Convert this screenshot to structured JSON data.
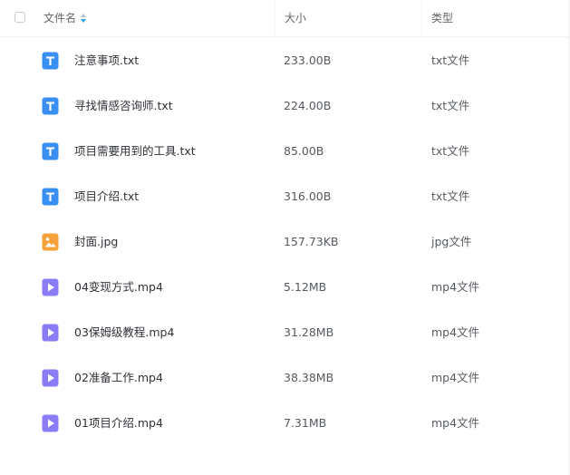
{
  "header": {
    "name_label": "文件名",
    "size_label": "大小",
    "type_label": "类型"
  },
  "colors": {
    "txt_icon": "#3a8ff5",
    "jpg_icon": "#f6a23b",
    "mp4_icon": "#8a7cf7"
  },
  "files": [
    {
      "name": "注意事项.txt",
      "size": "233.00B",
      "type": "txt文件",
      "icon": "text-file-icon",
      "kind": "txt"
    },
    {
      "name": "寻找情感咨询师.txt",
      "size": "224.00B",
      "type": "txt文件",
      "icon": "text-file-icon",
      "kind": "txt"
    },
    {
      "name": "项目需要用到的工具.txt",
      "size": "85.00B",
      "type": "txt文件",
      "icon": "text-file-icon",
      "kind": "txt"
    },
    {
      "name": "项目介绍.txt",
      "size": "316.00B",
      "type": "txt文件",
      "icon": "text-file-icon",
      "kind": "txt"
    },
    {
      "name": "封面.jpg",
      "size": "157.73KB",
      "type": "jpg文件",
      "icon": "image-file-icon",
      "kind": "jpg"
    },
    {
      "name": "04变现方式.mp4",
      "size": "5.12MB",
      "type": "mp4文件",
      "icon": "video-file-icon",
      "kind": "mp4"
    },
    {
      "name": "03保姆级教程.mp4",
      "size": "31.28MB",
      "type": "mp4文件",
      "icon": "video-file-icon",
      "kind": "mp4"
    },
    {
      "name": "02准备工作.mp4",
      "size": "38.38MB",
      "type": "mp4文件",
      "icon": "video-file-icon",
      "kind": "mp4"
    },
    {
      "name": "01项目介绍.mp4",
      "size": "7.31MB",
      "type": "mp4文件",
      "icon": "video-file-icon",
      "kind": "mp4"
    }
  ]
}
